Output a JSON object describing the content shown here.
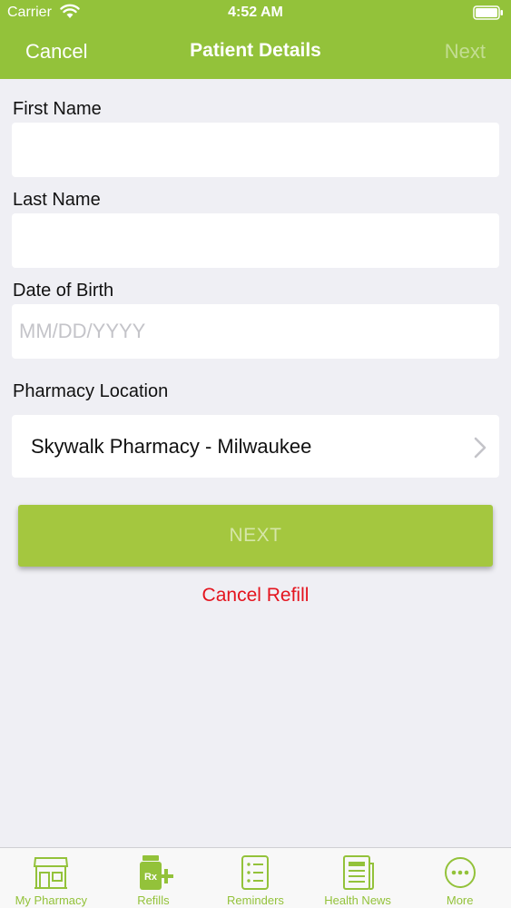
{
  "status_bar": {
    "carrier": "Carrier",
    "time": "4:52 AM"
  },
  "nav": {
    "cancel_label": "Cancel",
    "title": "Patient Details",
    "next_label": "Next"
  },
  "form": {
    "first_name_label": "First Name",
    "first_name_value": "",
    "last_name_label": "Last Name",
    "last_name_value": "",
    "dob_label": "Date of Birth",
    "dob_placeholder": "MM/DD/YYYY",
    "dob_value": "",
    "pharmacy_location_label": "Pharmacy Location",
    "pharmacy_location_value": "Skywalk Pharmacy - Milwaukee"
  },
  "actions": {
    "next_button_label": "NEXT",
    "cancel_refill_label": "Cancel Refill"
  },
  "tabs": [
    {
      "label": "My Pharmacy",
      "icon": "pharmacy-icon"
    },
    {
      "label": "Refills",
      "icon": "rx-refill-icon"
    },
    {
      "label": "Reminders",
      "icon": "reminders-list-icon"
    },
    {
      "label": "Health News",
      "icon": "news-icon"
    },
    {
      "label": "More",
      "icon": "more-icon"
    }
  ],
  "colors": {
    "brand_green": "#93c23a",
    "button_green": "#a4c73f",
    "cancel_red": "#e4141e",
    "background": "#efeff4"
  }
}
